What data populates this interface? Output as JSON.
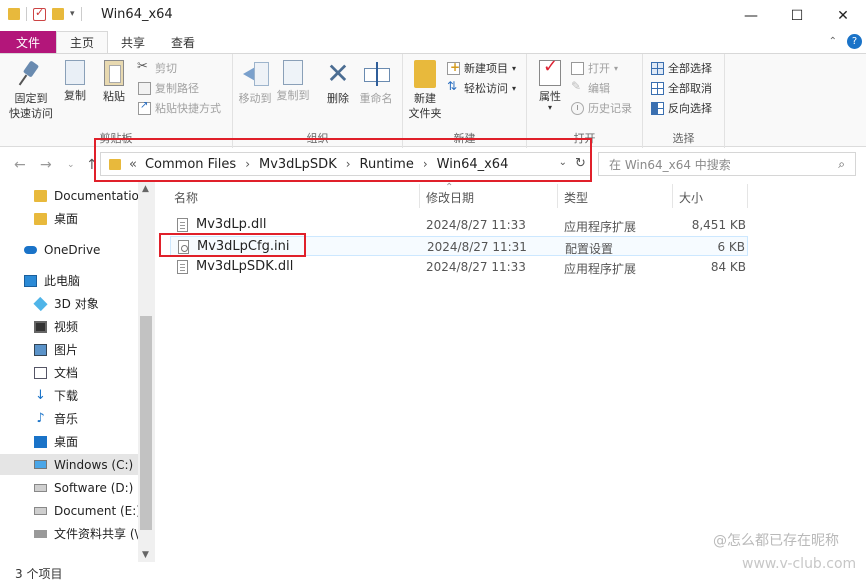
{
  "window": {
    "title": "Win64_x64",
    "controls": {
      "minimize": "—",
      "maximize": "☐",
      "close": "✕"
    }
  },
  "ribbon_tabs": [
    {
      "label": "文件"
    },
    {
      "label": "主页"
    },
    {
      "label": "共享"
    },
    {
      "label": "查看"
    }
  ],
  "ribbon": {
    "clipboard": {
      "label": "剪贴板",
      "pin": "固定到\n快速访问",
      "copy": "复制",
      "paste": "粘贴",
      "cut": "剪切",
      "copy_path": "复制路径",
      "paste_shortcut": "粘贴快捷方式"
    },
    "organize": {
      "label": "组织",
      "move_to": "移动到",
      "copy_to": "复制到",
      "delete": "删除",
      "rename": "重命名"
    },
    "new": {
      "label": "新建",
      "new_folder": "新建\n文件夹",
      "new_item": "新建项目",
      "easy_access": "轻松访问"
    },
    "open": {
      "label": "打开",
      "properties": "属性",
      "open": "打开",
      "edit": "编辑",
      "history": "历史记录"
    },
    "select": {
      "label": "选择",
      "select_all": "全部选择",
      "select_none": "全部取消",
      "invert": "反向选择"
    }
  },
  "address": {
    "overflow": "«",
    "crumbs": [
      "Common Files",
      "Mv3dLpSDK",
      "Runtime",
      "Win64_x64"
    ],
    "search_placeholder": "在 Win64_x64 中搜索"
  },
  "nav_pane": [
    {
      "label": "Documentation",
      "icon": "folder-icon"
    },
    {
      "label": "桌面",
      "icon": "folder-icon"
    },
    {
      "label": "OneDrive",
      "icon": "cloud-icon"
    },
    {
      "label": "此电脑",
      "icon": "pc-icon"
    },
    {
      "label": "3D 对象",
      "icon": "3d-objects-icon"
    },
    {
      "label": "视频",
      "icon": "video-icon"
    },
    {
      "label": "图片",
      "icon": "pictures-icon"
    },
    {
      "label": "文档",
      "icon": "documents-icon"
    },
    {
      "label": "下载",
      "icon": "download-icon"
    },
    {
      "label": "音乐",
      "icon": "music-icon"
    },
    {
      "label": "桌面",
      "icon": "desktop-icon"
    },
    {
      "label": "Windows (C:)",
      "icon": "windows-drive-icon"
    },
    {
      "label": "Software (D:)",
      "icon": "drive-icon"
    },
    {
      "label": "Document (E:)",
      "icon": "drive-icon"
    },
    {
      "label": "文件资料共享 (\\\\",
      "icon": "network-drive-icon"
    }
  ],
  "columns": {
    "name": "名称",
    "date": "修改日期",
    "type": "类型",
    "size": "大小"
  },
  "files": [
    {
      "name": "Mv3dLp.dll",
      "date": "2024/8/27 11:33",
      "type": "应用程序扩展",
      "size": "8,451 KB"
    },
    {
      "name": "Mv3dLpCfg.ini",
      "date": "2024/8/27 11:31",
      "type": "配置设置",
      "size": "6 KB"
    },
    {
      "name": "Mv3dLpSDK.dll",
      "date": "2024/8/27 11:33",
      "type": "应用程序扩展",
      "size": "84 KB"
    }
  ],
  "status": {
    "count": "3 个项目"
  },
  "watermark": {
    "line1": "@怎么都已存在昵称",
    "line2": "www.v-club.com"
  },
  "colors": {
    "file_tab": "#b3167a",
    "highlight": "#e0202a",
    "accent": "#1a73c8"
  }
}
